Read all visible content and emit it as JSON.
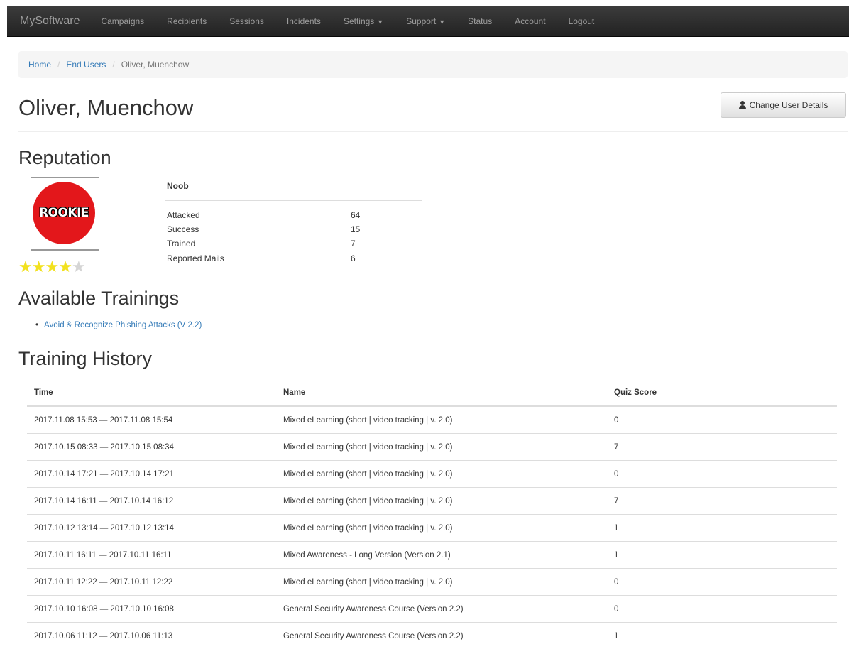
{
  "navbar": {
    "brand": "MySoftware",
    "items": [
      {
        "label": "Campaigns"
      },
      {
        "label": "Recipients"
      },
      {
        "label": "Sessions"
      },
      {
        "label": "Incidents"
      },
      {
        "label": "Settings",
        "dropdown": true
      },
      {
        "label": "Support",
        "dropdown": true
      },
      {
        "label": "Status"
      },
      {
        "label": "Account"
      },
      {
        "label": "Logout"
      }
    ]
  },
  "breadcrumb": {
    "home": "Home",
    "section": "End Users",
    "current": "Oliver, Muenchow",
    "separator": "/"
  },
  "header": {
    "title": "Oliver, Muenchow",
    "change_button": "Change User Details"
  },
  "reputation": {
    "heading": "Reputation",
    "badge_text": "ROOKIE",
    "badge_color": "#e3171b",
    "stars_filled": 4,
    "stars_total": 5,
    "level": "Noob",
    "stats": [
      {
        "label": "Attacked",
        "value": "64"
      },
      {
        "label": "Success",
        "value": "15"
      },
      {
        "label": "Trained",
        "value": "7"
      },
      {
        "label": "Reported Mails",
        "value": "6"
      }
    ]
  },
  "trainings": {
    "heading": "Available Trainings",
    "items": [
      "Avoid & Recognize Phishing Attacks (V 2.2)"
    ]
  },
  "history": {
    "heading": "Training History",
    "columns": [
      "Time",
      "Name",
      "Quiz Score"
    ],
    "rows": [
      {
        "time": "2017.11.08 15:53 — 2017.11.08 15:54",
        "name": "Mixed eLearning (short | video tracking | v. 2.0)",
        "score": "0"
      },
      {
        "time": "2017.10.15 08:33 — 2017.10.15 08:34",
        "name": "Mixed eLearning (short | video tracking | v. 2.0)",
        "score": "7"
      },
      {
        "time": "2017.10.14 17:21 — 2017.10.14 17:21",
        "name": "Mixed eLearning (short | video tracking | v. 2.0)",
        "score": "0"
      },
      {
        "time": "2017.10.14 16:11 — 2017.10.14 16:12",
        "name": "Mixed eLearning (short | video tracking | v. 2.0)",
        "score": "7"
      },
      {
        "time": "2017.10.12 13:14 — 2017.10.12 13:14",
        "name": "Mixed eLearning (short | video tracking | v. 2.0)",
        "score": "1"
      },
      {
        "time": "2017.10.11 16:11 — 2017.10.11 16:11",
        "name": "Mixed Awareness - Long Version (Version 2.1)",
        "score": "1"
      },
      {
        "time": "2017.10.11 12:22 — 2017.10.11 12:22",
        "name": "Mixed eLearning (short | video tracking | v. 2.0)",
        "score": "0"
      },
      {
        "time": "2017.10.10 16:08 — 2017.10.10 16:08",
        "name": "General Security Awareness Course (Version 2.2)",
        "score": "0"
      },
      {
        "time": "2017.10.06 11:12 — 2017.10.06 11:13",
        "name": "General Security Awareness Course (Version 2.2)",
        "score": "1"
      }
    ]
  }
}
